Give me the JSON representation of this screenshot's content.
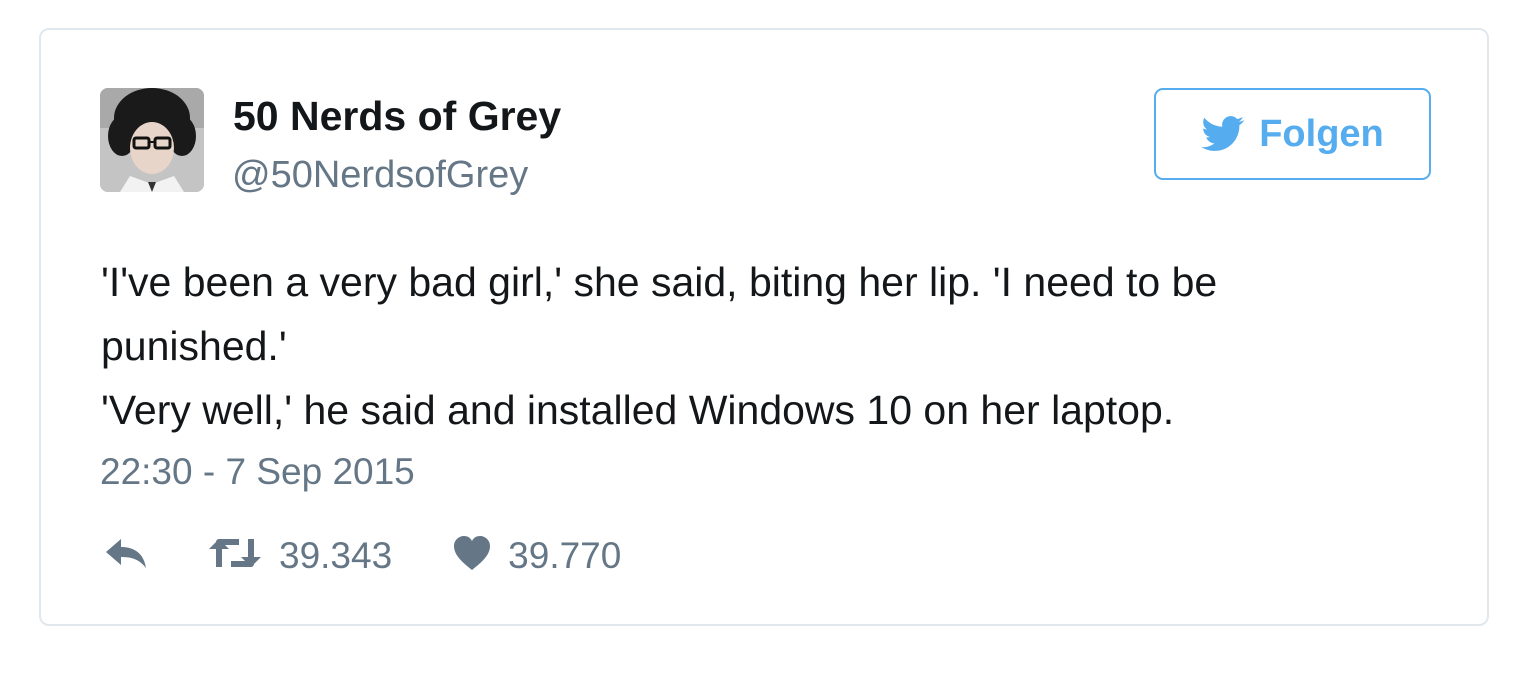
{
  "tweet": {
    "author": {
      "name": "50 Nerds of Grey",
      "handle": "@50NerdsofGrey",
      "avatar_icon": "profile-photo"
    },
    "follow_button": {
      "label": "Folgen",
      "icon": "twitter-bird-icon",
      "color": "#55acee"
    },
    "text_lines": [
      "'I've been a very bad girl,' she said, biting her lip. 'I need to be",
      "punished.'",
      "'Very well,' he said and installed Windows 10 on her laptop."
    ],
    "timestamp": "22:30 - 7 Sep 2015",
    "actions": {
      "reply": {
        "icon": "reply-icon"
      },
      "retweet": {
        "icon": "retweet-icon",
        "count": "39.343"
      },
      "like": {
        "icon": "heart-icon",
        "count": "39.770"
      }
    },
    "colors": {
      "text": "#14171a",
      "secondary": "#657786",
      "border": "#e1e8ed",
      "accent": "#55acee"
    }
  }
}
